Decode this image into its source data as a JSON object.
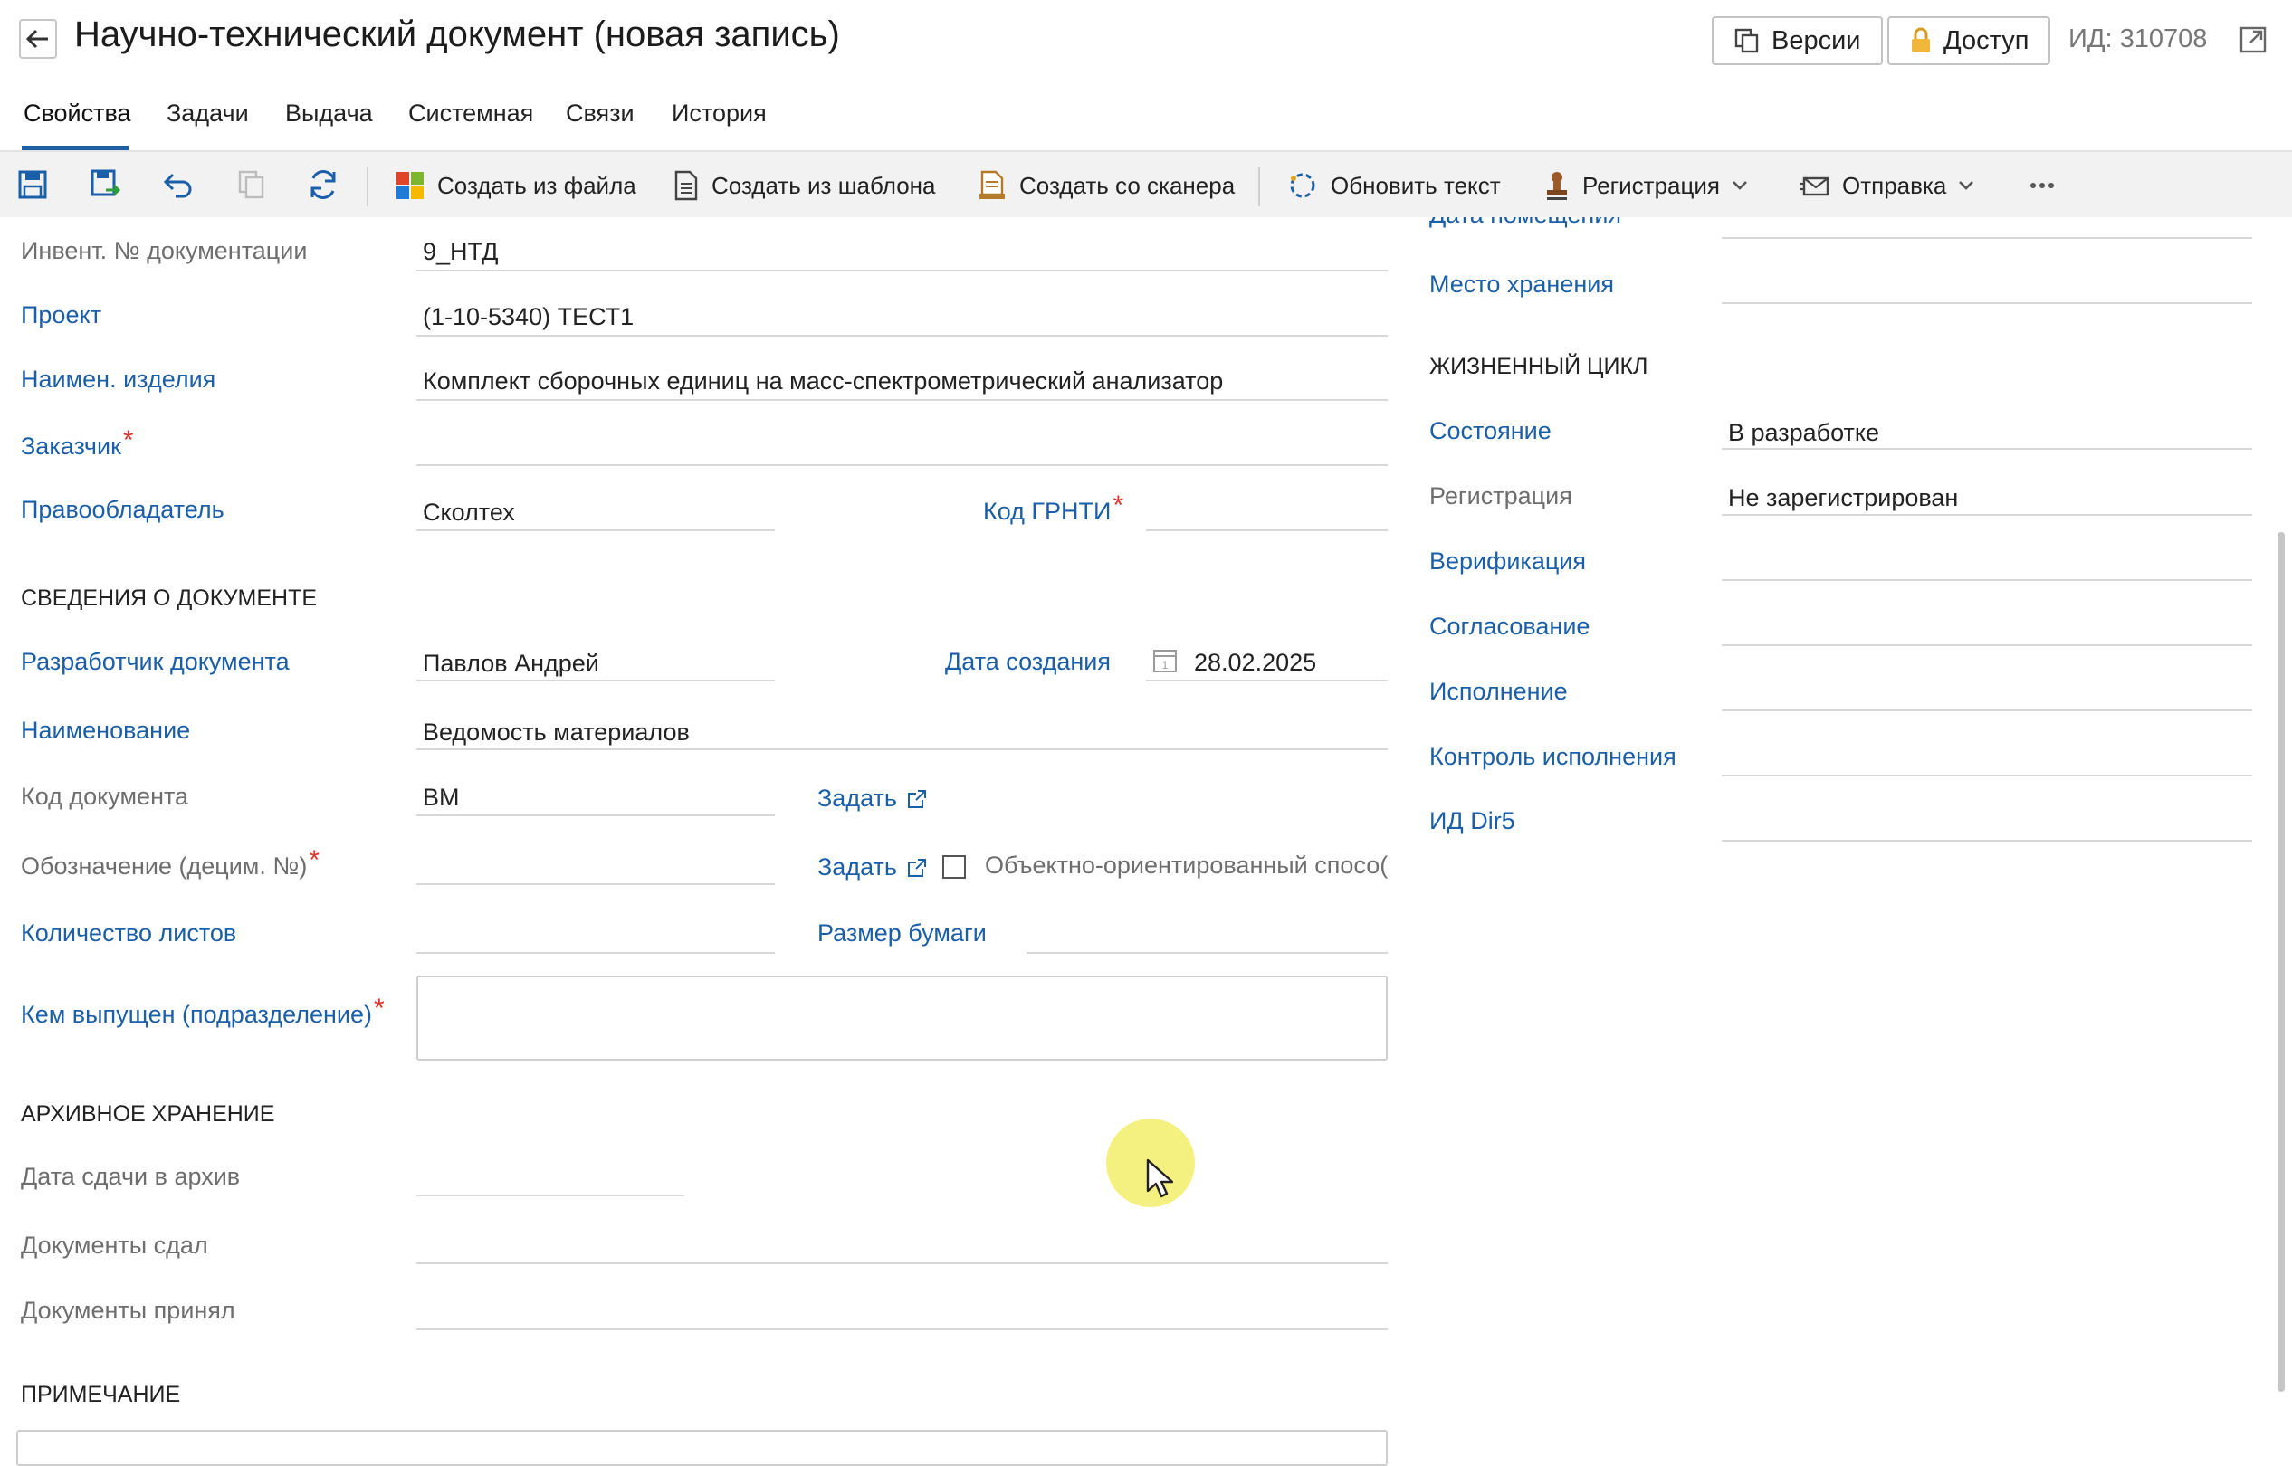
{
  "header": {
    "title": "Научно-технический документ (новая запись)",
    "versions_label": "Версии",
    "access_label": "Доступ",
    "id_text": "ИД: 310708"
  },
  "tabs": [
    {
      "label": "Свойства",
      "active": true
    },
    {
      "label": "Задачи"
    },
    {
      "label": "Выдача"
    },
    {
      "label": "Системная"
    },
    {
      "label": "Связи"
    },
    {
      "label": "История"
    }
  ],
  "toolbar": {
    "create_from_file": "Создать из файла",
    "create_from_template": "Создать из шаблона",
    "create_from_scanner": "Создать со сканера",
    "refresh_text": "Обновить текст",
    "registration": "Регистрация",
    "send": "Отправка"
  },
  "left": {
    "inv_label": "Инвент. № документации",
    "inv_value": "9_НТД",
    "project_label": "Проект",
    "project_value": "(1-10-5340) ТЕСТ1",
    "product_label": "Наимен. изделия",
    "product_value": "Комплект сборочных единиц на масс-спектрометрический анализатор",
    "customer_label": "Заказчик",
    "owner_label": "Правообладатель",
    "owner_value": "Сколтех",
    "grnti_label": "Код ГРНТИ",
    "section_doc": "СВЕДЕНИЯ О ДОКУМЕНТЕ",
    "developer_label": "Разработчик документа",
    "developer_value": "Павлов Андрей",
    "created_label": "Дата создания",
    "created_value": "28.02.2025",
    "calendar_day": "1",
    "name_label": "Наименование",
    "name_value": "Ведомость материалов",
    "doc_code_label": "Код документа",
    "doc_code_value": "ВМ",
    "set_label": "Задать",
    "designation_label": "Обозначение (децим. №)",
    "object_oriented_label": "Объектно-ориентированный спосо(",
    "sheets_label": "Количество листов",
    "paper_label": "Размер бумаги",
    "issued_label": "Кем выпущен (подразделение)",
    "section_archive": "АРХИВНОЕ ХРАНЕНИЕ",
    "archive_date_label": "Дата сдачи в архив",
    "handed_label": "Документы сдал",
    "accepted_label": "Документы принял",
    "section_note": "ПРИМЕЧАНИЕ"
  },
  "right": {
    "placement_label": "Дата помещения",
    "storage_label": "Место хранения",
    "section_lifecycle": "ЖИЗНЕННЫЙ ЦИКЛ",
    "state_label": "Состояние",
    "state_value": "В разработке",
    "registration_label": "Регистрация",
    "registration_value": "Не зарегистрирован",
    "verification_label": "Верификация",
    "approval_label": "Согласование",
    "execution_label": "Исполнение",
    "exec_control_label": "Контроль исполнения",
    "dir5_label": "ИД Dir5"
  },
  "colors": {
    "accent": "#1b5fa8",
    "required": "#d9342b",
    "cursor_highlight": "#f3ef6a"
  }
}
